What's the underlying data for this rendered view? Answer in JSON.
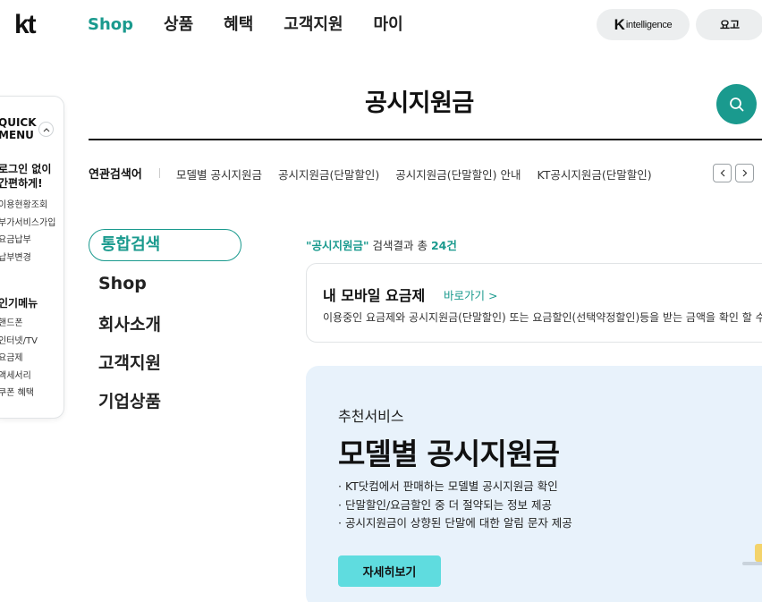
{
  "header": {
    "logo": "kt",
    "nav": [
      "Shop",
      "상품",
      "혜택",
      "고객지원",
      "마이"
    ],
    "active_nav": "Shop",
    "k_intelligence": {
      "k": "K",
      "rest": "intelligence"
    },
    "fee_button": "요고"
  },
  "quick_menu": {
    "title_line1": "QUICK",
    "title_line2": "MENU",
    "toggle_icon": "chevron-up-icon",
    "login_line1": "로그인 없이",
    "login_line2": "간편하게!",
    "links": [
      "이용현황조회",
      "부가서비스가입",
      "요금납부",
      "납부변경"
    ],
    "popular_title": "인기메뉴",
    "popular_links": [
      "핸드폰",
      "인터넷/TV",
      "요금제",
      "액세서리",
      "쿠폰 혜택"
    ]
  },
  "search": {
    "title": "공시지원금",
    "icon": "search-icon",
    "related_label": "연관검색어",
    "related": [
      "모델별 공시지원금",
      "공시지원금(단말할인)",
      "공시지원금(단말할인) 안내",
      "KT공시지원금(단말할인)"
    ],
    "prev_icon": "chevron-left-icon",
    "next_icon": "chevron-right-icon"
  },
  "categories": {
    "active": "통합검색",
    "items": [
      "Shop",
      "회사소개",
      "고객지원",
      "기업상품"
    ]
  },
  "results": {
    "keyword": "\"공시지원금\"",
    "count_prefix": " 검색결과 총 ",
    "count": "24건",
    "card": {
      "title": "내 모바일 요금제",
      "link": "바로가기 >",
      "desc": "이용중인 요금제와 공시지원금(단말할인) 또는 요금할인(선택약정할인)등을 받는 금액을 확인 할 수 있어요."
    }
  },
  "banner": {
    "label": "추천서비스",
    "title": "모델별 공시지원금",
    "bullets": [
      "· KT닷컴에서 판매하는 모델별 공시지원금 확인",
      "· 단말할인/요금할인 중 더 절약되는 정보 제공",
      "· 공시지원금이 상향된 단말에 대한 알림 문자 제공"
    ],
    "button": "자세히보기",
    "bg_color": "#e8f2fb",
    "button_color": "#5fdcdf"
  },
  "colors": {
    "accent": "#1a9a8e"
  }
}
